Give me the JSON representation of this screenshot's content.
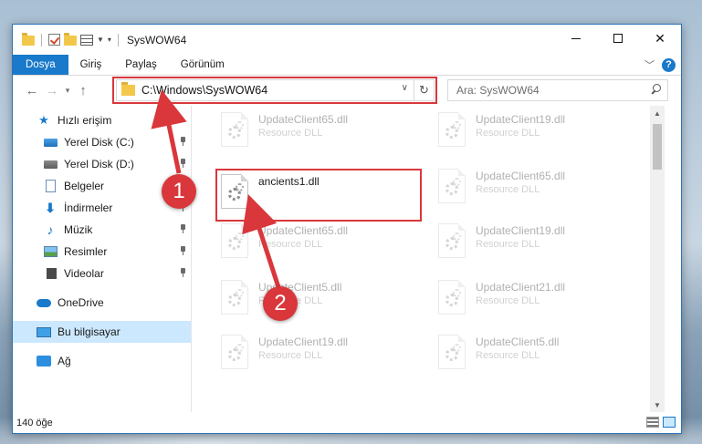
{
  "window": {
    "title": "SysWOW64",
    "controls": {
      "minimize": "minimize-icon",
      "maximize": "maximize-icon",
      "close": "✕"
    }
  },
  "ribbon": {
    "tabs": [
      "Dosya",
      "Giriş",
      "Paylaş",
      "Görünüm"
    ],
    "help": "?"
  },
  "navigation": {
    "path": "C:\\Windows\\SysWOW64",
    "search_placeholder": "Ara: SysWOW64",
    "refresh": "↻"
  },
  "sidebar": {
    "items": [
      {
        "label": "Hızlı erişim",
        "icon": "star-icon"
      },
      {
        "label": "Yerel Disk (C:)",
        "icon": "drive-icon",
        "pinned": true
      },
      {
        "label": "Yerel Disk (D:)",
        "icon": "drive-icon",
        "pinned": true
      },
      {
        "label": "Belgeler",
        "icon": "document-icon",
        "pinned": true
      },
      {
        "label": "İndirmeler",
        "icon": "download-icon",
        "pinned": true
      },
      {
        "label": "Müzik",
        "icon": "music-icon",
        "pinned": true
      },
      {
        "label": "Resimler",
        "icon": "pictures-icon",
        "pinned": true
      },
      {
        "label": "Videolar",
        "icon": "videos-icon",
        "pinned": true
      },
      {
        "label": "OneDrive",
        "icon": "cloud-icon"
      },
      {
        "label": "Bu bilgisayar",
        "icon": "computer-icon",
        "selected": true
      },
      {
        "label": "Ağ",
        "icon": "network-icon"
      }
    ]
  },
  "files": {
    "left_column": [
      {
        "name": "UpdateClient65.dll",
        "type": "Resource DLL"
      },
      {
        "name": "ancients1.dll",
        "type": ""
      },
      {
        "name": "UpdateClient65.dll",
        "type": "Resource DLL"
      },
      {
        "name": "UpdateClient5.dll",
        "type": "Resource DLL"
      },
      {
        "name": "UpdateClient19.dll",
        "type": "Resource DLL"
      }
    ],
    "right_column": [
      {
        "name": "UpdateClient19.dll",
        "type": "Resource DLL"
      },
      {
        "name": "UpdateClient65.dll",
        "type": "Resource DLL"
      },
      {
        "name": "UpdateClient19.dll",
        "type": "Resource DLL"
      },
      {
        "name": "UpdateClient21.dll",
        "type": "Resource DLL"
      },
      {
        "name": "UpdateClient5.dll",
        "type": "Resource DLL"
      }
    ]
  },
  "status": {
    "item_count": "140 öğe"
  },
  "annotations": {
    "step1": "1",
    "step2": "2",
    "highlight_color": "#d9373b"
  }
}
